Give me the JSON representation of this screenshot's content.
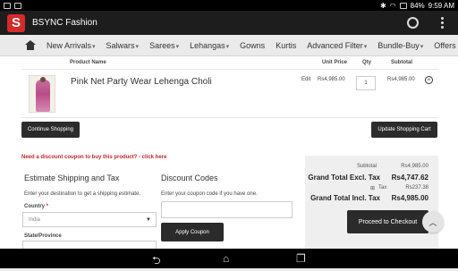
{
  "status": {
    "battery": "84%",
    "time": "9:59 AM"
  },
  "app": {
    "logo_letter": "S",
    "title": "BSYNC Fashion"
  },
  "nav": {
    "items": [
      {
        "label": "New Arrivals",
        "caret": true
      },
      {
        "label": "Salwars",
        "caret": true
      },
      {
        "label": "Sarees",
        "caret": true
      },
      {
        "label": "Lehangas",
        "caret": true
      },
      {
        "label": "Gowns",
        "caret": false
      },
      {
        "label": "Kurtis",
        "caret": false
      },
      {
        "label": "Advanced Filter",
        "caret": true
      },
      {
        "label": "Bundle-Buy",
        "caret": true
      },
      {
        "label": "Offers",
        "caret": false
      }
    ],
    "caret_glyph": "▾"
  },
  "cart": {
    "headers": {
      "product_name": "Product Name",
      "unit_price": "Unit Price",
      "qty": "Qty",
      "subtotal": "Subtotal"
    },
    "item": {
      "name": "Pink Net Party Wear Lehenga Choli",
      "edit": "Edit",
      "unit_price": "Rs4,985.00",
      "qty": "1",
      "subtotal": "Rs4,985.00"
    }
  },
  "buttons": {
    "continue": "Continue Shopping",
    "update": "Update Shopping Cart",
    "apply": "Apply Coupon",
    "checkout": "Proceed to Checkout"
  },
  "coupon_link": "Need a discount coupon to buy this product? - click here",
  "shipping": {
    "title": "Estimate Shipping and Tax",
    "hint": "Enter your destination to get a shipping estimate.",
    "country_label": "Country",
    "required_mark": "*",
    "country_value": "India",
    "state_label": "State/Province"
  },
  "discount": {
    "title": "Discount Codes",
    "hint": "Enter your coupon code if you have one."
  },
  "totals": {
    "subtotal_label": "Subtotal",
    "subtotal_value": "Rs4,985.00",
    "excl_label": "Grand Total Excl. Tax",
    "excl_value": "Rs4,747.62",
    "tax_label": "Tax",
    "tax_value": "Rs237.38",
    "incl_label": "Grand Total Incl. Tax",
    "incl_value": "Rs4,985.00"
  }
}
